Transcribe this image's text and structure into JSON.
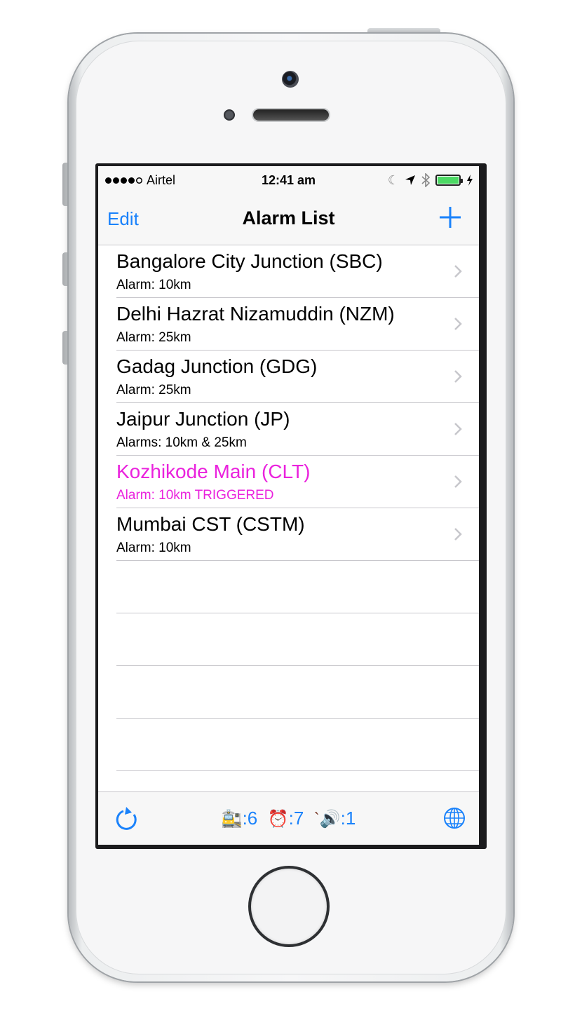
{
  "statusbar": {
    "signal_dots": [
      true,
      true,
      true,
      true,
      false
    ],
    "carrier": "Airtel",
    "time": "12:41 am",
    "icons": [
      "moon-icon",
      "location-arrow-icon",
      "bluetooth-icon",
      "battery-icon",
      "charging-bolt-icon"
    ],
    "battery_color": "#4cd964"
  },
  "navbar": {
    "edit_label": "Edit",
    "title": "Alarm List",
    "add_icon": "plus-icon"
  },
  "accent_color": "#1a82fb",
  "triggered_color": "#ea22dd",
  "alarms": [
    {
      "title": "Bangalore City Junction (SBC)",
      "subtitle": "Alarm: 10km",
      "triggered": false
    },
    {
      "title": "Delhi Hazrat Nizamuddin (NZM)",
      "subtitle": "Alarm: 25km",
      "triggered": false
    },
    {
      "title": "Gadag Junction (GDG)",
      "subtitle": "Alarm: 25km",
      "triggered": false
    },
    {
      "title": "Jaipur Junction (JP)",
      "subtitle": "Alarms: 10km & 25km",
      "triggered": false
    },
    {
      "title": "Kozhikode Main (CLT)",
      "subtitle": "Alarm: 10km TRIGGERED",
      "triggered": true
    },
    {
      "title": "Mumbai CST (CSTM)",
      "subtitle": "Alarm: 10km",
      "triggered": false
    }
  ],
  "toolbar": {
    "refresh_icon": "refresh-icon",
    "station_emoji": "🚉",
    "station_count": ":6",
    "alarm_emoji": "⏰",
    "alarm_count": ":7",
    "sound_emoji": "`🔊",
    "sound_count": ":1",
    "globe_icon": "globe-icon"
  }
}
